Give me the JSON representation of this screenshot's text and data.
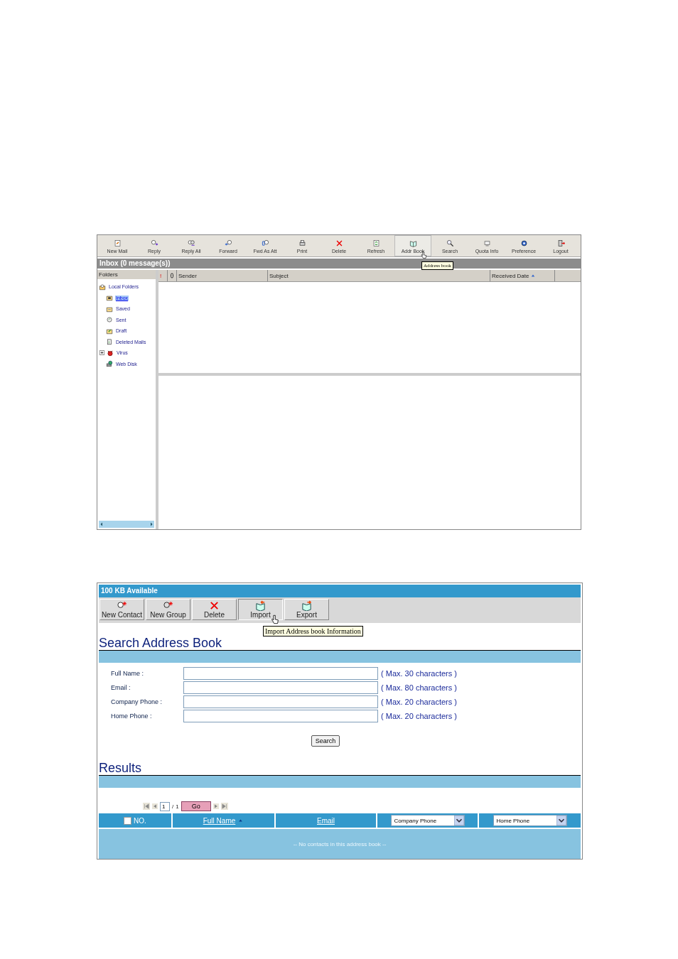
{
  "mail_window": {
    "toolbar": [
      {
        "label": "New Mail",
        "selected": false
      },
      {
        "label": "Reply",
        "selected": false
      },
      {
        "label": "Reply All",
        "selected": false
      },
      {
        "label": "Forward",
        "selected": false
      },
      {
        "label": "Fwd As Att",
        "selected": false
      },
      {
        "label": "Print",
        "selected": false
      },
      {
        "label": "Delete",
        "selected": false
      },
      {
        "label": "Refresh",
        "selected": false
      },
      {
        "label": "Addr Book",
        "selected": true
      },
      {
        "label": "Search",
        "selected": false
      },
      {
        "label": "Quota Info",
        "selected": false
      },
      {
        "label": "Preference",
        "selected": false
      },
      {
        "label": "Logout",
        "selected": false
      }
    ],
    "tooltip": "Address book",
    "title": "Inbox (0 message(s))",
    "folders_header": "Folders",
    "folders": [
      {
        "label": "Local Folders",
        "selected": false,
        "expandable": false,
        "children": [
          {
            "label": "Inbox",
            "selected": true,
            "expandable": false
          },
          {
            "label": "Saved",
            "selected": false,
            "expandable": false
          },
          {
            "label": "Sent",
            "selected": false,
            "expandable": false
          },
          {
            "label": "Draft",
            "selected": false,
            "expandable": false
          },
          {
            "label": "Deleted Mails",
            "selected": false,
            "expandable": false
          },
          {
            "label": "Virus",
            "selected": false,
            "expandable": true
          },
          {
            "label": "Web Disk",
            "selected": false,
            "expandable": false
          }
        ]
      }
    ],
    "priority_header": "!",
    "columns": [
      {
        "label": "Sender",
        "sorted": false
      },
      {
        "label": "Subject",
        "sorted": false
      },
      {
        "label": "Received Date",
        "sorted": true
      }
    ]
  },
  "address_book": {
    "quota": "100 KB Available",
    "toolbar": [
      {
        "label": "New Contact",
        "selected": false
      },
      {
        "label": "New Group",
        "selected": false
      },
      {
        "label": "Delete",
        "selected": false
      },
      {
        "label": "Import",
        "selected": true
      },
      {
        "label": "Export",
        "selected": false
      }
    ],
    "tooltip": "Import Address book Information",
    "search_heading": "Search Address Book",
    "fields": [
      {
        "label": "Full Name :",
        "hint": "( Max. 30 characters )"
      },
      {
        "label": "Email :",
        "hint": "( Max. 80 characters )"
      },
      {
        "label": "Company Phone :",
        "hint": "( Max. 20 characters )"
      },
      {
        "label": "Home Phone :",
        "hint": "( Max. 20 characters )"
      }
    ],
    "search_button": "Search",
    "results_heading": "Results",
    "pager": {
      "page": "1",
      "separator": "/",
      "total": "1",
      "go": "Go"
    },
    "columns": [
      {
        "kind": "checkbox",
        "label": "NO.",
        "checked": false
      },
      {
        "kind": "link",
        "label": "Full Name",
        "sorted": true
      },
      {
        "kind": "link",
        "label": "Email",
        "sorted": false
      },
      {
        "kind": "select",
        "label": "Company Phone"
      },
      {
        "kind": "select",
        "label": "Home Phone"
      }
    ],
    "empty_message": "-- No contacts in this address book --"
  }
}
